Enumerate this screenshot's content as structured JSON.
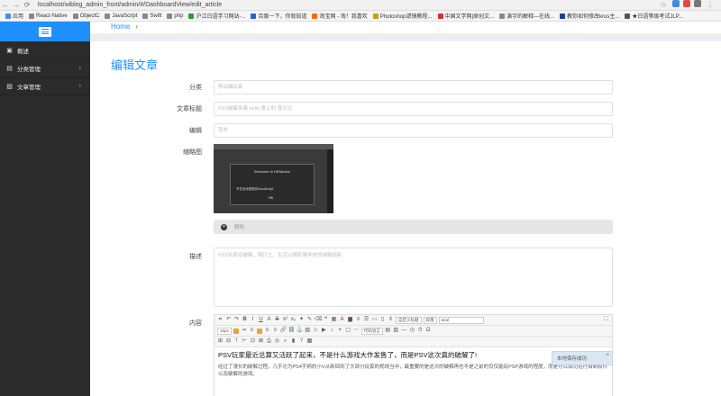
{
  "browser": {
    "url": "localhost/wiblog_admin_front/admin/#/DashboardView/edit_article",
    "bookmarks": [
      {
        "label": "应用",
        "color": "#4a90e2"
      },
      {
        "label": "React-Native",
        "color": "#888888"
      },
      {
        "label": "ObjectC",
        "color": "#888888"
      },
      {
        "label": "JavaScript",
        "color": "#888888"
      },
      {
        "label": "Swift",
        "color": "#888888"
      },
      {
        "label": "php",
        "color": "#888888"
      },
      {
        "label": "沪江日语学习网站-...",
        "color": "#2e9d2e"
      },
      {
        "label": "百度一下，你就知道",
        "color": "#2b5fd9"
      },
      {
        "label": "淘宝网 - 淘！我喜欢",
        "color": "#ff6a00"
      },
      {
        "label": "Photoshop滤镜教程...",
        "color": "#c8a000"
      },
      {
        "label": "中国文学网|原创文...",
        "color": "#cc3333"
      },
      {
        "label": "演字的解释---在线...",
        "color": "#888888"
      },
      {
        "label": "教你如何修改krus主...",
        "color": "#1a3d8f"
      },
      {
        "label": "★日语等级考试JLP...",
        "color": "#555555"
      }
    ]
  },
  "sidebar": {
    "items": [
      {
        "label": "概述",
        "icon": "dashboard-icon",
        "has_chevron": false
      },
      {
        "label": "分类管理",
        "icon": "folder-icon",
        "has_chevron": true
      },
      {
        "label": "文章管理",
        "icon": "image-icon",
        "has_chevron": true
      }
    ]
  },
  "breadcrumb": {
    "home": "Home",
    "separator": "›"
  },
  "page_title": "编辑文章",
  "form": {
    "category": {
      "label": "分类",
      "placeholder": "移动端玩家"
    },
    "title": {
      "label": "文章标题",
      "placeholder": "PSV破解来袭 hello 爱上的 我对大"
    },
    "editor": {
      "label": "编辑",
      "placeholder": "苏东"
    },
    "thumbnail": {
      "label": "缩略图",
      "dialog_title": "Welcome to HENkaku!",
      "dialog_body": "不在自动更新的JavaScript",
      "dialog_ok": "OK"
    },
    "delete_label": "删除",
    "description": {
      "label": "描述",
      "placeholder": "PSV玩家在破解，随行之，生活以精彩事件这些细致前影"
    },
    "content": {
      "label": "内容",
      "heading": "PSV玩家最近总算又活跃了起来，不是什么游戏大作发售了，而是PSV这次真的破解了!",
      "paragraph": "经过了漫长的破解过程，几乎沦为PS4手柄的小V从新回到了大部分玩家的视线当中，最重要的是这次的破解再也不是之前的仅仅能玩PSP游戏的程度，而是可以成功运行自制软件以及破解的游戏。",
      "red_line": "……"
    }
  },
  "toolbar": {
    "custom_title": "自定义标题",
    "paragraph_format": "段落",
    "font_family": "arial",
    "font_size": "16px",
    "code_lang": "代码语言"
  },
  "toast": {
    "text": "本地保存成功",
    "close": "×"
  },
  "colors": {
    "accent": "#1e90ff",
    "sidebar_bg": "#2b2b2b"
  }
}
